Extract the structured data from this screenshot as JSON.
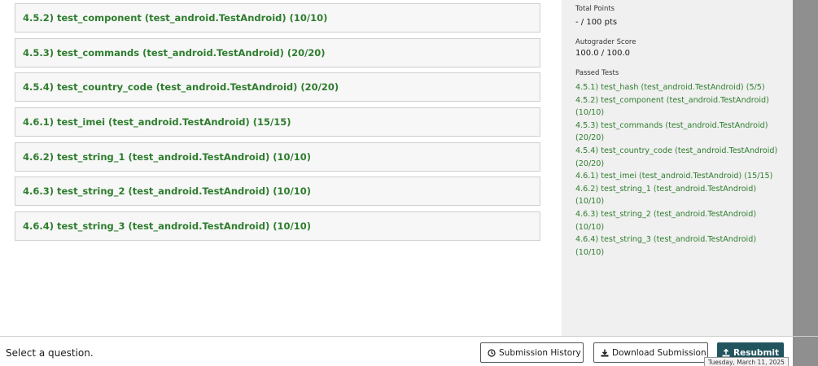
{
  "tests": [
    "4.5.2) test_component (test_android.TestAndroid) (10/10)",
    "4.5.3) test_commands (test_android.TestAndroid) (20/20)",
    "4.5.4) test_country_code (test_android.TestAndroid) (20/20)",
    "4.6.1) test_imei (test_android.TestAndroid) (15/15)",
    "4.6.2) test_string_1 (test_android.TestAndroid) (10/10)",
    "4.6.3) test_string_2 (test_android.TestAndroid) (10/10)",
    "4.6.4) test_string_3 (test_android.TestAndroid) (10/10)"
  ],
  "sidebar": {
    "total_points_label": "Total Points",
    "total_points_value": "- / 100 pts",
    "autograder_label": "Autograder Score",
    "autograder_value": "100.0 / 100.0",
    "passed_label": "Passed Tests",
    "passed_tests": [
      "4.5.1) test_hash (test_android.TestAndroid) (5/5)",
      "4.5.2) test_component (test_android.TestAndroid)",
      "(10/10)",
      "4.5.3) test_commands (test_android.TestAndroid)",
      "(20/20)",
      "4.5.4) test_country_code (test_android.TestAndroid)",
      "(20/20)",
      "4.6.1) test_imei (test_android.TestAndroid) (15/15)",
      "4.6.2) test_string_1 (test_android.TestAndroid) (10/10)",
      "4.6.3) test_string_2 (test_android.TestAndroid) (10/10)",
      "4.6.4) test_string_3 (test_android.TestAndroid) (10/10)"
    ]
  },
  "footer": {
    "prompt": "Select a question.",
    "history_label": "Submission History",
    "download_label": "Download Submission",
    "resubmit_label": "Resubmit",
    "tooltip": "Tuesday, March 11, 2025"
  },
  "colors": {
    "link_green": "#2e7d2e",
    "resubmit_bg": "#21545e",
    "sidebar_bg": "#f0f0f0"
  },
  "icons": {
    "history": "clock-icon",
    "download": "download-icon",
    "resubmit": "upload-icon"
  }
}
